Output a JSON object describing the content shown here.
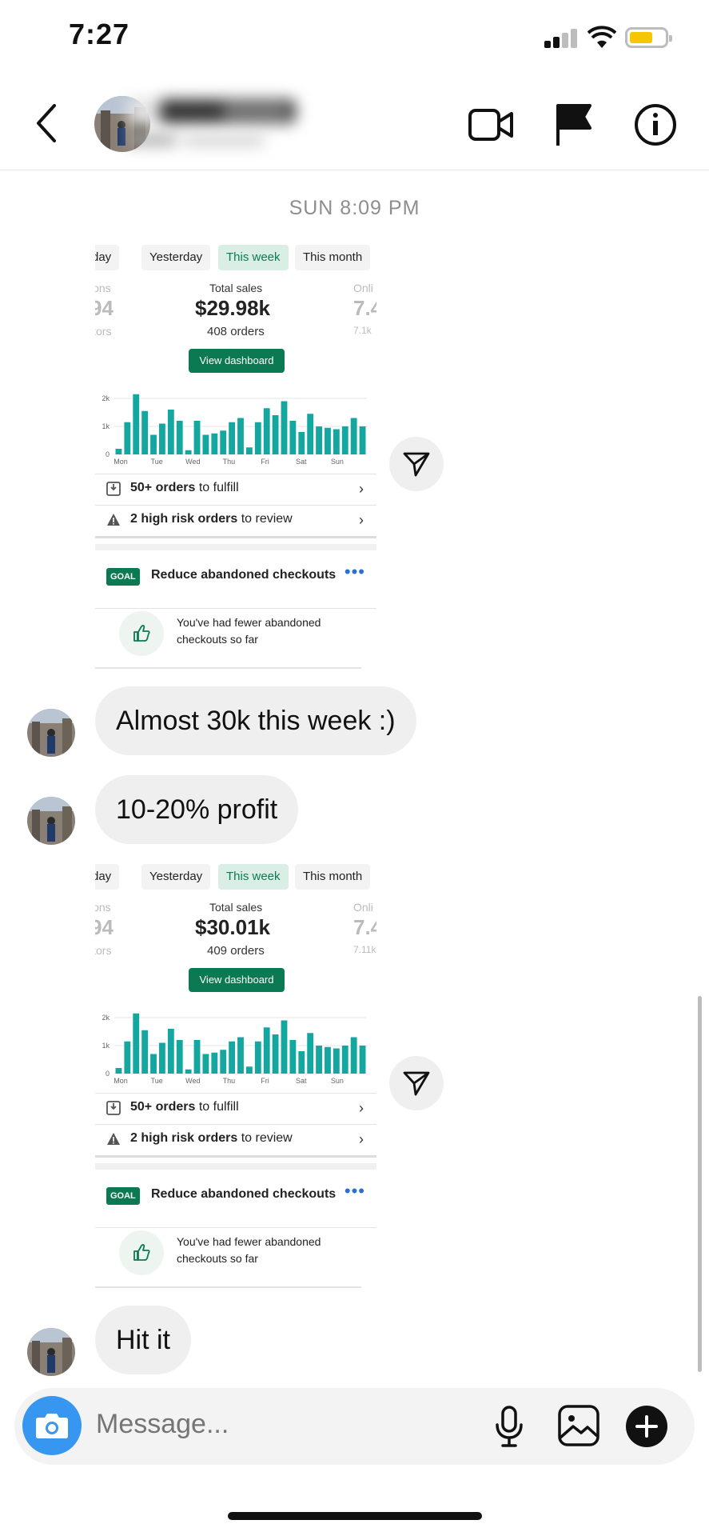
{
  "status_bar": {
    "time": "7:27"
  },
  "header": {
    "back_icon": "chevron-left-icon",
    "icons": [
      "video-camera-icon",
      "flag-icon",
      "info-icon"
    ]
  },
  "thread": {
    "timestamp": "SUN 8:09 PM",
    "shared_screenshots": [
      {
        "tabs": [
          "day",
          "Yesterday",
          "This week",
          "This month"
        ],
        "active_tab": "This week",
        "left_stat": {
          "label": "ions",
          "value": "94",
          "sub": "itors"
        },
        "center_stat": {
          "label": "Total sales",
          "value": "$29.98k",
          "sub": "408 orders"
        },
        "right_stat": {
          "label": "Onli",
          "value": "7.4",
          "sub": "7.1k"
        },
        "view_dashboard": "View dashboard",
        "chart_data": {
          "type": "bar",
          "y_ticks": [
            "2k",
            "1k",
            "0"
          ],
          "x_ticks": [
            "Mon",
            "Tue",
            "Wed",
            "Thu",
            "Fri",
            "Sat",
            "Sun"
          ],
          "ylim": [
            0,
            2400
          ],
          "values": [
            200,
            1150,
            2150,
            1550,
            700,
            1100,
            1600,
            1200,
            150,
            1200,
            700,
            750,
            850,
            1150,
            1300,
            250,
            1150,
            1650,
            1400,
            1900,
            1200,
            800,
            1450,
            1000,
            950,
            900,
            1000,
            1300,
            1000
          ]
        },
        "fulfill": {
          "bold": "50+ orders",
          "rest": " to fulfill"
        },
        "risk": {
          "bold": "2 high risk orders",
          "rest": " to review"
        },
        "goal": {
          "badge": "GOAL",
          "text": "Reduce abandoned checkouts",
          "menu": "•••"
        },
        "fewer": "You've had fewer abandoned checkouts so far"
      },
      {
        "tabs": [
          "day",
          "Yesterday",
          "This week",
          "This month"
        ],
        "active_tab": "This week",
        "left_stat": {
          "label": "ions",
          "value": "94",
          "sub": "itors"
        },
        "center_stat": {
          "label": "Total sales",
          "value": "$30.01k",
          "sub": "409 orders"
        },
        "right_stat": {
          "label": "Onli",
          "value": "7.4",
          "sub": "7.11k"
        },
        "view_dashboard": "View dashboard",
        "chart_data": {
          "type": "bar",
          "y_ticks": [
            "2k",
            "1k",
            "0"
          ],
          "x_ticks": [
            "Mon",
            "Tue",
            "Wed",
            "Thu",
            "Fri",
            "Sat",
            "Sun"
          ],
          "ylim": [
            0,
            2400
          ],
          "values": [
            200,
            1150,
            2150,
            1550,
            700,
            1100,
            1600,
            1200,
            150,
            1200,
            700,
            750,
            850,
            1150,
            1300,
            250,
            1150,
            1650,
            1400,
            1900,
            1200,
            800,
            1450,
            1000,
            950,
            900,
            1000,
            1300,
            1000
          ]
        },
        "fulfill": {
          "bold": "50+ orders",
          "rest": " to fulfill"
        },
        "risk": {
          "bold": "2 high risk orders",
          "rest": " to review"
        },
        "goal": {
          "badge": "GOAL",
          "text": "Reduce abandoned checkouts",
          "menu": "•••"
        },
        "fewer": "You've had fewer abandoned checkouts so far"
      }
    ],
    "messages": [
      "Almost 30k this week :)",
      "10-20% profit",
      "Hit it"
    ]
  },
  "composer": {
    "placeholder": "Message..."
  },
  "colors": {
    "accent_green": "#0b7a53",
    "bar_teal": "#14a7a0",
    "camera_blue": "#3797f0",
    "bubble_gray": "#efefef"
  }
}
